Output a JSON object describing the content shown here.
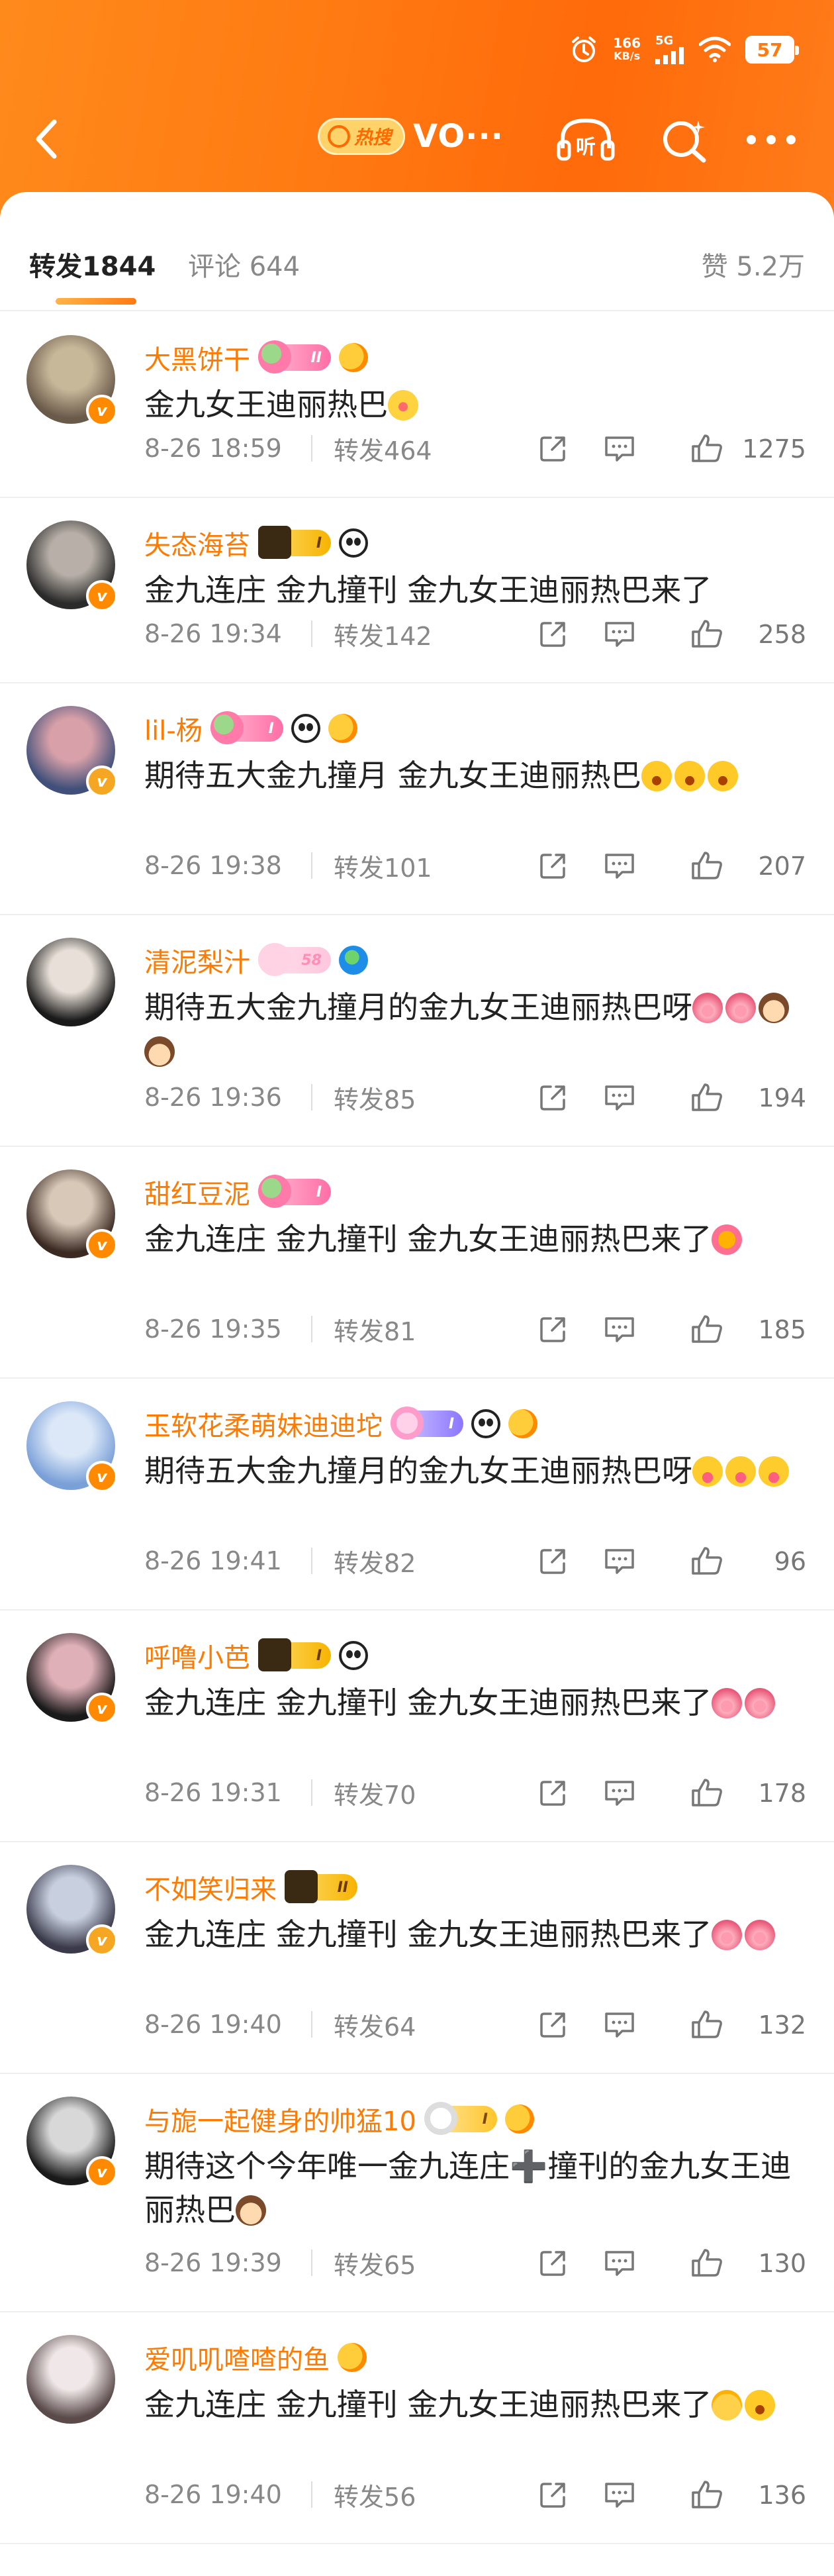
{
  "status_bar": {
    "speed_value": "166",
    "speed_unit": "KB/s",
    "network": "5G",
    "battery": "57"
  },
  "nav": {
    "hot_badge": "热搜",
    "title": "VO···",
    "listen_label": "听"
  },
  "tabs": {
    "repost_label": "转发",
    "repost_count": "1844",
    "comment_label": "评论",
    "comment_count": "644",
    "like_label": "赞",
    "like_count": "5.2万"
  },
  "items": [
    {
      "username": "大黑饼干",
      "level": "II",
      "level_style": "pink",
      "extra_icons": [
        "fish-icon"
      ],
      "verified": "orange",
      "avatar_colors": [
        "#c8b89a",
        "#6a5a4a"
      ],
      "text": "金九女王迪丽热巴",
      "emojis": [
        "kiss"
      ],
      "time": "8-26 18:59",
      "repost_label": "转发",
      "repost_count": "464",
      "likes": "1275"
    },
    {
      "username": "失态海苔",
      "level": "I",
      "level_style": "gold",
      "extra_icons": [
        "panda-icon"
      ],
      "verified": "orange",
      "avatar_colors": [
        "#b8b0a8",
        "#2a2a2a"
      ],
      "text": "金九连庄 金九撞刊 金九女王迪丽热巴来了",
      "emojis": [],
      "time": "8-26 19:34",
      "repost_label": "转发",
      "repost_count": "142",
      "likes": "258"
    },
    {
      "username": "lil-杨",
      "level": "I",
      "level_style": "pink",
      "extra_icons": [
        "panda-icon",
        "fish-icon"
      ],
      "verified": "gold",
      "avatar_colors": [
        "#d8a0a8",
        "#40507a"
      ],
      "text": "期待五大金九撞月 金九女王迪丽热巴",
      "emojis": [
        "wow",
        "wow",
        "wow"
      ],
      "time": "8-26 19:38",
      "repost_label": "转发",
      "repost_count": "101",
      "likes": "207"
    },
    {
      "username": "清泥梨汁",
      "level": "58",
      "level_style": "faded",
      "extra_icons": [
        "globe-icon"
      ],
      "verified": "",
      "avatar_colors": [
        "#e8e0d8",
        "#1a1a1a"
      ],
      "text": "期待五大金九撞月的金九女王迪丽热巴呀",
      "emojis": [
        "pig",
        "pig",
        "princess",
        "princess"
      ],
      "time": "8-26 19:36",
      "repost_label": "转发",
      "repost_count": "85",
      "likes": "194"
    },
    {
      "username": "甜红豆泥",
      "level": "I",
      "level_style": "pink",
      "extra_icons": [],
      "verified": "orange",
      "avatar_colors": [
        "#d8c8b8",
        "#3a2a22"
      ],
      "text": "金九连庄 金九撞刊 金九女王迪丽热巴来了",
      "emojis": [
        "star"
      ],
      "time": "8-26 19:35",
      "repost_label": "转发",
      "repost_count": "81",
      "likes": "185"
    },
    {
      "username": "玉软花柔萌妹迪迪坨",
      "level": "I",
      "level_style": "purple",
      "extra_icons": [
        "panda-icon",
        "fish-icon"
      ],
      "verified": "orange",
      "avatar_colors": [
        "#dce8f8",
        "#7aa0d8"
      ],
      "text": "期待五大金九撞月的金九女王迪丽热巴呀",
      "emojis": [
        "lick",
        "lick",
        "lick"
      ],
      "time": "8-26 19:41",
      "repost_label": "转发",
      "repost_count": "82",
      "likes": "96"
    },
    {
      "username": "呼噜小芭",
      "level": "I",
      "level_style": "gold",
      "extra_icons": [
        "panda-icon"
      ],
      "verified": "orange",
      "avatar_colors": [
        "#e0b0b8",
        "#1a1a1a"
      ],
      "text": "金九连庄 金九撞刊 金九女王迪丽热巴来了",
      "emojis": [
        "pig",
        "pig"
      ],
      "time": "8-26 19:31",
      "repost_label": "转发",
      "repost_count": "70",
      "likes": "178"
    },
    {
      "username": "不如笑归来",
      "level": "II",
      "level_style": "gold",
      "extra_icons": [],
      "verified": "gold",
      "avatar_colors": [
        "#c8d0e0",
        "#3a3a4a"
      ],
      "text": "金九连庄 金九撞刊 金九女王迪丽热巴来了",
      "emojis": [
        "pig",
        "pig"
      ],
      "time": "8-26 19:40",
      "repost_label": "转发",
      "repost_count": "64",
      "likes": "132"
    },
    {
      "username": "与旎一起健身的帅猛10",
      "level": "I",
      "level_style": "yellow",
      "extra_icons": [
        "fish-icon"
      ],
      "verified": "orange",
      "avatar_colors": [
        "#d8d8d8",
        "#1a1a1a"
      ],
      "text": "期待这个今年唯一金九连庄➕撞刊的金九女王迪丽热巴",
      "emojis": [
        "princess"
      ],
      "time": "8-26 19:39",
      "repost_label": "转发",
      "repost_count": "65",
      "likes": "130"
    },
    {
      "username": "爱叽叽喳喳的鱼",
      "level": "",
      "level_style": "",
      "extra_icons": [
        "fish-icon"
      ],
      "verified": "",
      "avatar_colors": [
        "#f0e8e8",
        "#5a4a4a"
      ],
      "text": "金九连庄 金九撞刊 金九女王迪丽热巴来了",
      "emojis": [
        "sleep",
        "wow"
      ],
      "time": "8-26 19:40",
      "repost_label": "转发",
      "repost_count": "56",
      "likes": "136"
    }
  ]
}
